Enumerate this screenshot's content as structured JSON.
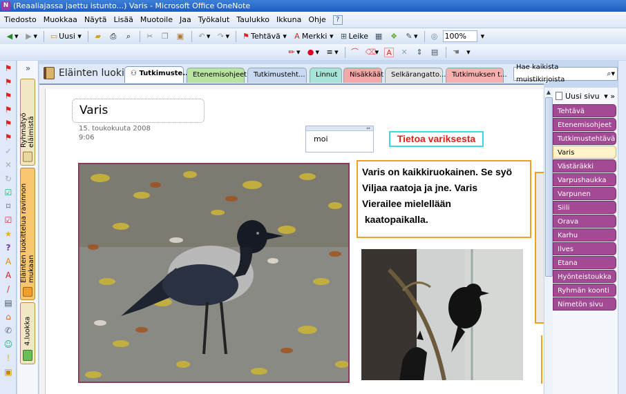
{
  "window": {
    "title": "(Reaaliajassa jaettu istunto...) Varis  - Microsoft Office OneNote"
  },
  "menu": {
    "items": [
      "Tiedosto",
      "Muokkaa",
      "Näytä",
      "Lisää",
      "Muotoile",
      "Jaa",
      "Työkalut",
      "Taulukko",
      "Ikkuna",
      "Ohje"
    ]
  },
  "toolbar": {
    "new_label": "Uusi",
    "task_label": "Tehtävä",
    "mark_label": "Merkki",
    "clip_label": "Leike",
    "zoom": "100%"
  },
  "notebook": {
    "title": "Eläinten luokit...",
    "vertical_tabs": [
      {
        "label": "Ryhmätyö eläimistä",
        "color": "#e9d7a2"
      },
      {
        "label": "Eläinten luokittelua ravinnon mukaan",
        "color": "#f0a030"
      },
      {
        "label": "4.luokka",
        "color": "#6bbf5a"
      }
    ]
  },
  "sections": [
    {
      "label": "Tutkimuste...",
      "color": "#c7d7f0",
      "active": true
    },
    {
      "label": "Etenemisohjeet",
      "color": "#b8e3a0",
      "active": false
    },
    {
      "label": "Tutkimusteht...",
      "color": "#c9d9f2",
      "active": false
    },
    {
      "label": "Linnut",
      "color": "#a7e3d6",
      "active": false
    },
    {
      "label": "Nisäkkäät",
      "color": "#f4a8a8",
      "active": false
    },
    {
      "label": "Selkärangatto...",
      "color": "#e2e2e2",
      "active": false
    },
    {
      "label": "Tutkimuksen t...",
      "color": "#f7b0b0",
      "active": false
    }
  ],
  "search": {
    "placeholder": "Hae kaikista muistikirjoista"
  },
  "page": {
    "title": "Varis",
    "date": "15. toukokuuta 2008",
    "time": "9:06",
    "note": "moi",
    "heading": "Tietoa variksesta",
    "body_lines": [
      "Varis on kaikkiruokainen.  Se syö",
      "Viljaa raatoja  ja jne. Varis",
      "Vierailee mielellään",
      " kaatopaikalla."
    ]
  },
  "pages_panel": {
    "new_page_label": "Uusi sivu",
    "items": [
      "Tehtävä",
      "Etenemisohjeet",
      "Tutkimustehtävä",
      "Varis",
      "Västäräkki",
      "Varpushaukka",
      "Varpunen",
      "Siili",
      "Orava",
      "Karhu",
      "Ilves",
      "Etana",
      "Hyönteistoukka",
      "Ryhmän koonti",
      "Nimetön sivu"
    ],
    "active_index": 3
  }
}
